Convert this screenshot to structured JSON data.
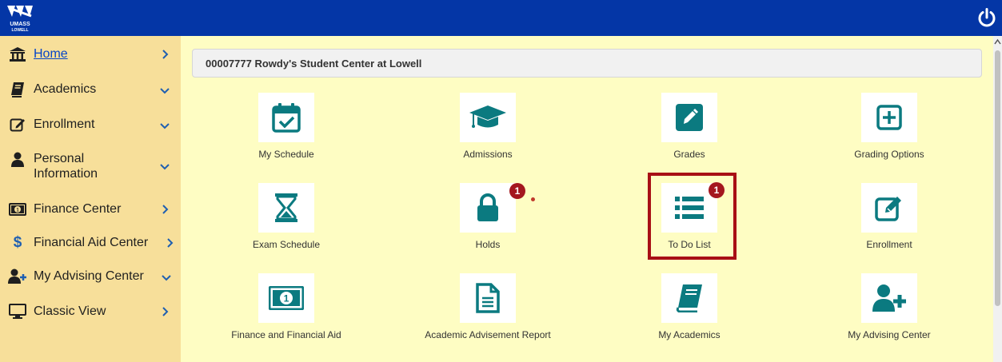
{
  "header": {
    "logo_text_1": "UMASS",
    "logo_text_2": "LOWELL"
  },
  "sidebar": {
    "items": [
      {
        "label": "Home",
        "icon": "building-columns-icon",
        "chevron": "right"
      },
      {
        "label": "Academics",
        "icon": "book-icon",
        "chevron": "down"
      },
      {
        "label": "Enrollment",
        "icon": "edit-icon",
        "chevron": "down"
      },
      {
        "label": "Personal Information",
        "label_line1": "Personal",
        "label_line2": "Information",
        "icon": "user-icon",
        "chevron": "down"
      },
      {
        "label": "Finance Center",
        "icon": "money-bill-icon",
        "chevron": "right"
      },
      {
        "label": "Financial Aid Center",
        "icon": "dollar-icon",
        "chevron": "right"
      },
      {
        "label": "My Advising Center",
        "icon": "user-plus-icon",
        "chevron": "down"
      },
      {
        "label": "Classic View",
        "icon": "monitor-icon",
        "chevron": "right"
      }
    ]
  },
  "main": {
    "page_title": "00007777 Rowdy's Student Center at Lowell",
    "tiles": [
      {
        "label": "My Schedule",
        "icon": "calendar-check-icon"
      },
      {
        "label": "Admissions",
        "icon": "graduation-cap-icon"
      },
      {
        "label": "Grades",
        "icon": "pencil-square-icon"
      },
      {
        "label": "Grading Options",
        "icon": "plus-square-icon"
      },
      {
        "label": "Exam Schedule",
        "icon": "hourglass-icon"
      },
      {
        "label": "Holds",
        "icon": "lock-icon",
        "badge": "1"
      },
      {
        "label": "To Do List",
        "icon": "list-icon",
        "badge": "1"
      },
      {
        "label": "Enrollment",
        "icon": "edit-icon"
      },
      {
        "label": "Finance and Financial Aid",
        "icon": "money-bill-icon"
      },
      {
        "label": "Academic Advisement Report",
        "icon": "document-icon"
      },
      {
        "label": "My Academics",
        "icon": "book-icon"
      },
      {
        "label": "My Advising Center",
        "icon": "user-plus-icon"
      }
    ]
  },
  "colors": {
    "topbar": "#0436a6",
    "sidebar": "#f7df9a",
    "main": "#fefdc3",
    "teal": "#0b7a80",
    "badge": "#a4171f",
    "highlight": "#a80f15"
  }
}
